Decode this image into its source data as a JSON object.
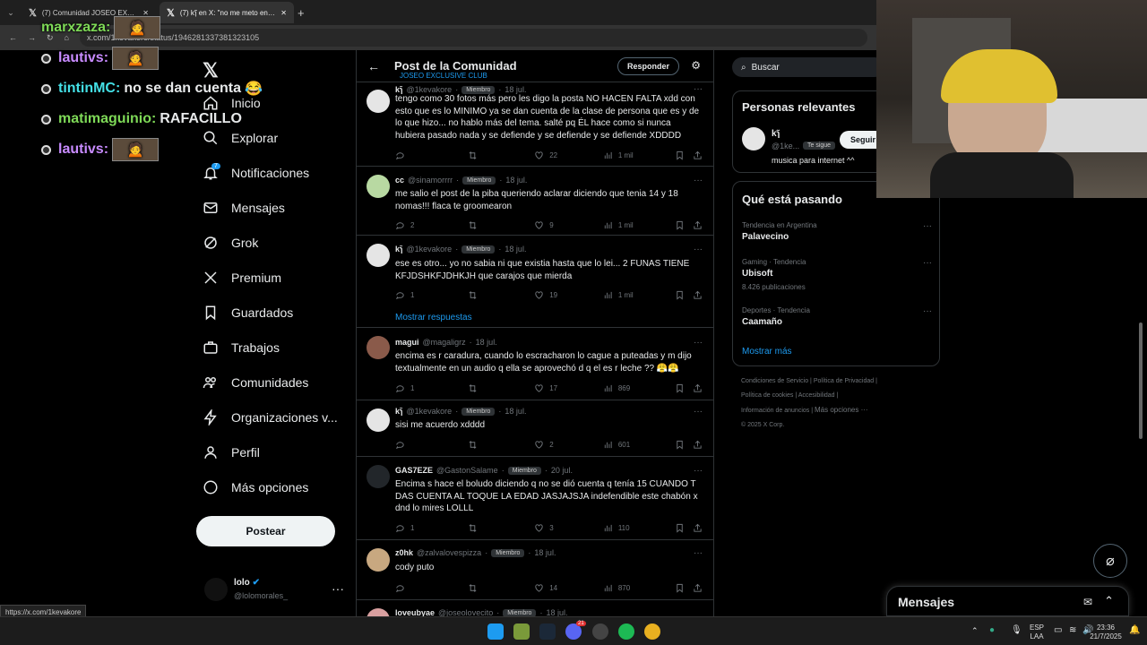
{
  "browser": {
    "tabs": [
      {
        "label": "(7) Comunidad JOSEO EXCLU..."
      },
      {
        "label": "(7) kɿ̃ en X: \"no me meto en qu..."
      }
    ],
    "url": "x.com/1kevakore/status/1946281337381323105",
    "status_url": "https://x.com/1kevakore"
  },
  "chat": [
    {
      "user": "marxzaza:",
      "text": "",
      "color": "#7ed957"
    },
    {
      "user": "lautivs:",
      "text": "",
      "color": "#c88bff"
    },
    {
      "user": "tintinMC:",
      "text": "no se dan cuenta",
      "color": "#44e0e6"
    },
    {
      "user": "matimaguinio:",
      "text": "RAFACILLO",
      "color": "#7ed957"
    },
    {
      "user": "lautivs:",
      "text": "",
      "color": "#c88bff"
    }
  ],
  "nav": {
    "items": [
      {
        "label": "Inicio"
      },
      {
        "label": "Explorar"
      },
      {
        "label": "Notificaciones",
        "badge": "7"
      },
      {
        "label": "Mensajes"
      },
      {
        "label": "Grok"
      },
      {
        "label": "Premium"
      },
      {
        "label": "Guardados"
      },
      {
        "label": "Trabajos"
      },
      {
        "label": "Comunidades"
      },
      {
        "label": "Organizaciones v..."
      },
      {
        "label": "Perfil"
      },
      {
        "label": "Más opciones"
      }
    ],
    "post_label": "Postear",
    "user_name": "lolo",
    "user_handle": "@lolomorales_"
  },
  "main": {
    "title": "Post de la Comunidad",
    "subtitle": "JOSEO EXCLUSIVE CLUB",
    "reply_label": "Responder",
    "show_replies": "Mostrar respuestas",
    "tweets": [
      {
        "name": "kɿ̃",
        "handle": "@1kevakore",
        "badge": "Miembro",
        "date": "18 jul.",
        "text": "tengo como 30 fotos más pero les digo la posta NO HACEN FALTA xdd con esto que es lo MINIMO ya se dan cuenta de la clase de persona que es y de lo que hizo... no hablo más del tema. salté pq ÉL hace como si nunca hubiera pasado nada y se defiende y se defiende y se defiende XDDDD",
        "replies": "",
        "likes": "22",
        "views": "1 mil"
      },
      {
        "name": "cc",
        "handle": "@sinamorrrr",
        "badge": "Miembro",
        "date": "18 jul.",
        "text": "me salio el post de la piba queriendo aclarar diciendo que tenia 14 y 18 nomas!!! flaca te groomearon",
        "replies": "2",
        "likes": "9",
        "views": "1 mil"
      },
      {
        "name": "kɿ̃",
        "handle": "@1kevakore",
        "badge": "Miembro",
        "date": "18 jul.",
        "text": "ese es otro... yo no sabia ni que existia hasta que lo lei... 2 FUNAS TIENE KFJDSHKFJDHKJH que carajos que mierda",
        "replies": "1",
        "likes": "19",
        "views": "1 mil"
      },
      {
        "name": "magui",
        "handle": "@magaligrz",
        "badge": "",
        "date": "18 jul.",
        "text": "encima es r caradura, cuando lo escracharon lo cague a puteadas y m dijo textualmente en un audio q ella se aprovechó d q el es r leche ?? 😤😤",
        "replies": "1",
        "likes": "17",
        "views": "869"
      },
      {
        "name": "kɿ̃",
        "handle": "@1kevakore",
        "badge": "Miembro",
        "date": "18 jul.",
        "text": "sisi me acuerdo xdddd",
        "replies": "",
        "likes": "2",
        "views": "601"
      },
      {
        "name": "GAS7EZE",
        "handle": "@GastonSalame",
        "badge": "Miembro",
        "date": "20 jul.",
        "text": "Encima s hace el boludo diciendo q no se dió cuenta q tenía 15 CUANDO T DAS CUENTA AL TOQUE LA EDAD JASJAJSJA indefendible este chabón x dnd lo mires LOLLL",
        "replies": "1",
        "likes": "3",
        "views": "110"
      },
      {
        "name": "z0hk",
        "handle": "@zalvalovespizza",
        "badge": "Miembro",
        "date": "18 jul.",
        "text": "cody puto",
        "replies": "",
        "likes": "14",
        "views": "870"
      },
      {
        "name": "loveubyae",
        "handle": "@joseolovecito",
        "badge": "Miembro",
        "date": "18 jul.",
        "text": "",
        "replies": "",
        "likes": "",
        "views": ""
      }
    ]
  },
  "right": {
    "search_placeholder": "Buscar",
    "relevant_title": "Personas relevantes",
    "relevant_name": "kɿ̃",
    "relevant_handle": "@1ke...",
    "relevant_follows": "Te sigue",
    "relevant_bio": "musica para internet ^^",
    "follow_label": "Seguir",
    "trends_title": "Qué está pasando",
    "trends": [
      {
        "cat": "Tendencia en Argentina",
        "name": "Palavecino",
        "count": ""
      },
      {
        "cat": "Gaming · Tendencia",
        "name": "Ubisoft",
        "count": "8.426 publicaciones"
      },
      {
        "cat": "Deportes · Tendencia",
        "name": "Caamaño",
        "count": ""
      }
    ],
    "show_more": "Mostrar más",
    "footer": [
      "Condiciones de Servicio",
      "Política de Privacidad",
      "Política de cookies",
      "Accesibilidad",
      "Información de anuncios",
      "Más opciones ···",
      "© 2025 X Corp."
    ]
  },
  "messages_label": "Mensajes",
  "taskbar": {
    "lang": "ESP",
    "lang2": "LAA",
    "time": "23:36",
    "date": "21/7/2025",
    "discord_badge": "21"
  },
  "colors": {
    "accent": "#1d9bf0",
    "muted": "#71767b",
    "bg": "#000000",
    "border": "#2f3336"
  }
}
